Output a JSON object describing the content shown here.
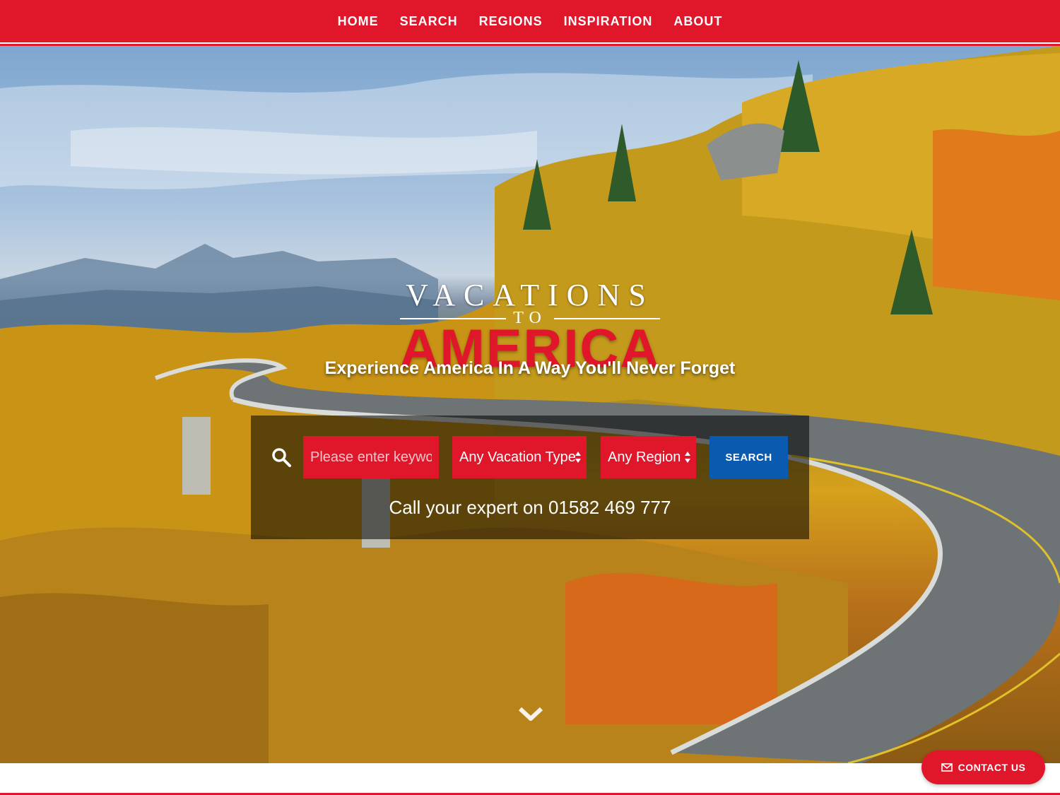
{
  "nav": {
    "items": [
      {
        "label": "HOME"
      },
      {
        "label": "SEARCH"
      },
      {
        "label": "REGIONS"
      },
      {
        "label": "INSPIRATION"
      },
      {
        "label": "ABOUT"
      }
    ]
  },
  "logo": {
    "line1": "VACATIONS",
    "line2": "TO",
    "line3": "AMERICA"
  },
  "hero": {
    "tagline": "Experience America In A Way You'll Never Forget"
  },
  "search": {
    "keyword_placeholder": "Please enter keyword",
    "vacation_type": "Any Vacation Type",
    "region": "Any Region",
    "button": "SEARCH",
    "call_text": "Call your expert on 01582 469 777"
  },
  "contact": {
    "label": "CONTACT US"
  },
  "colors": {
    "brand_red": "#e0172b",
    "search_blue": "#0a5bb0"
  },
  "icons": {
    "search": "search-icon",
    "scroll": "chevron-down-icon",
    "contact": "mail-icon"
  }
}
